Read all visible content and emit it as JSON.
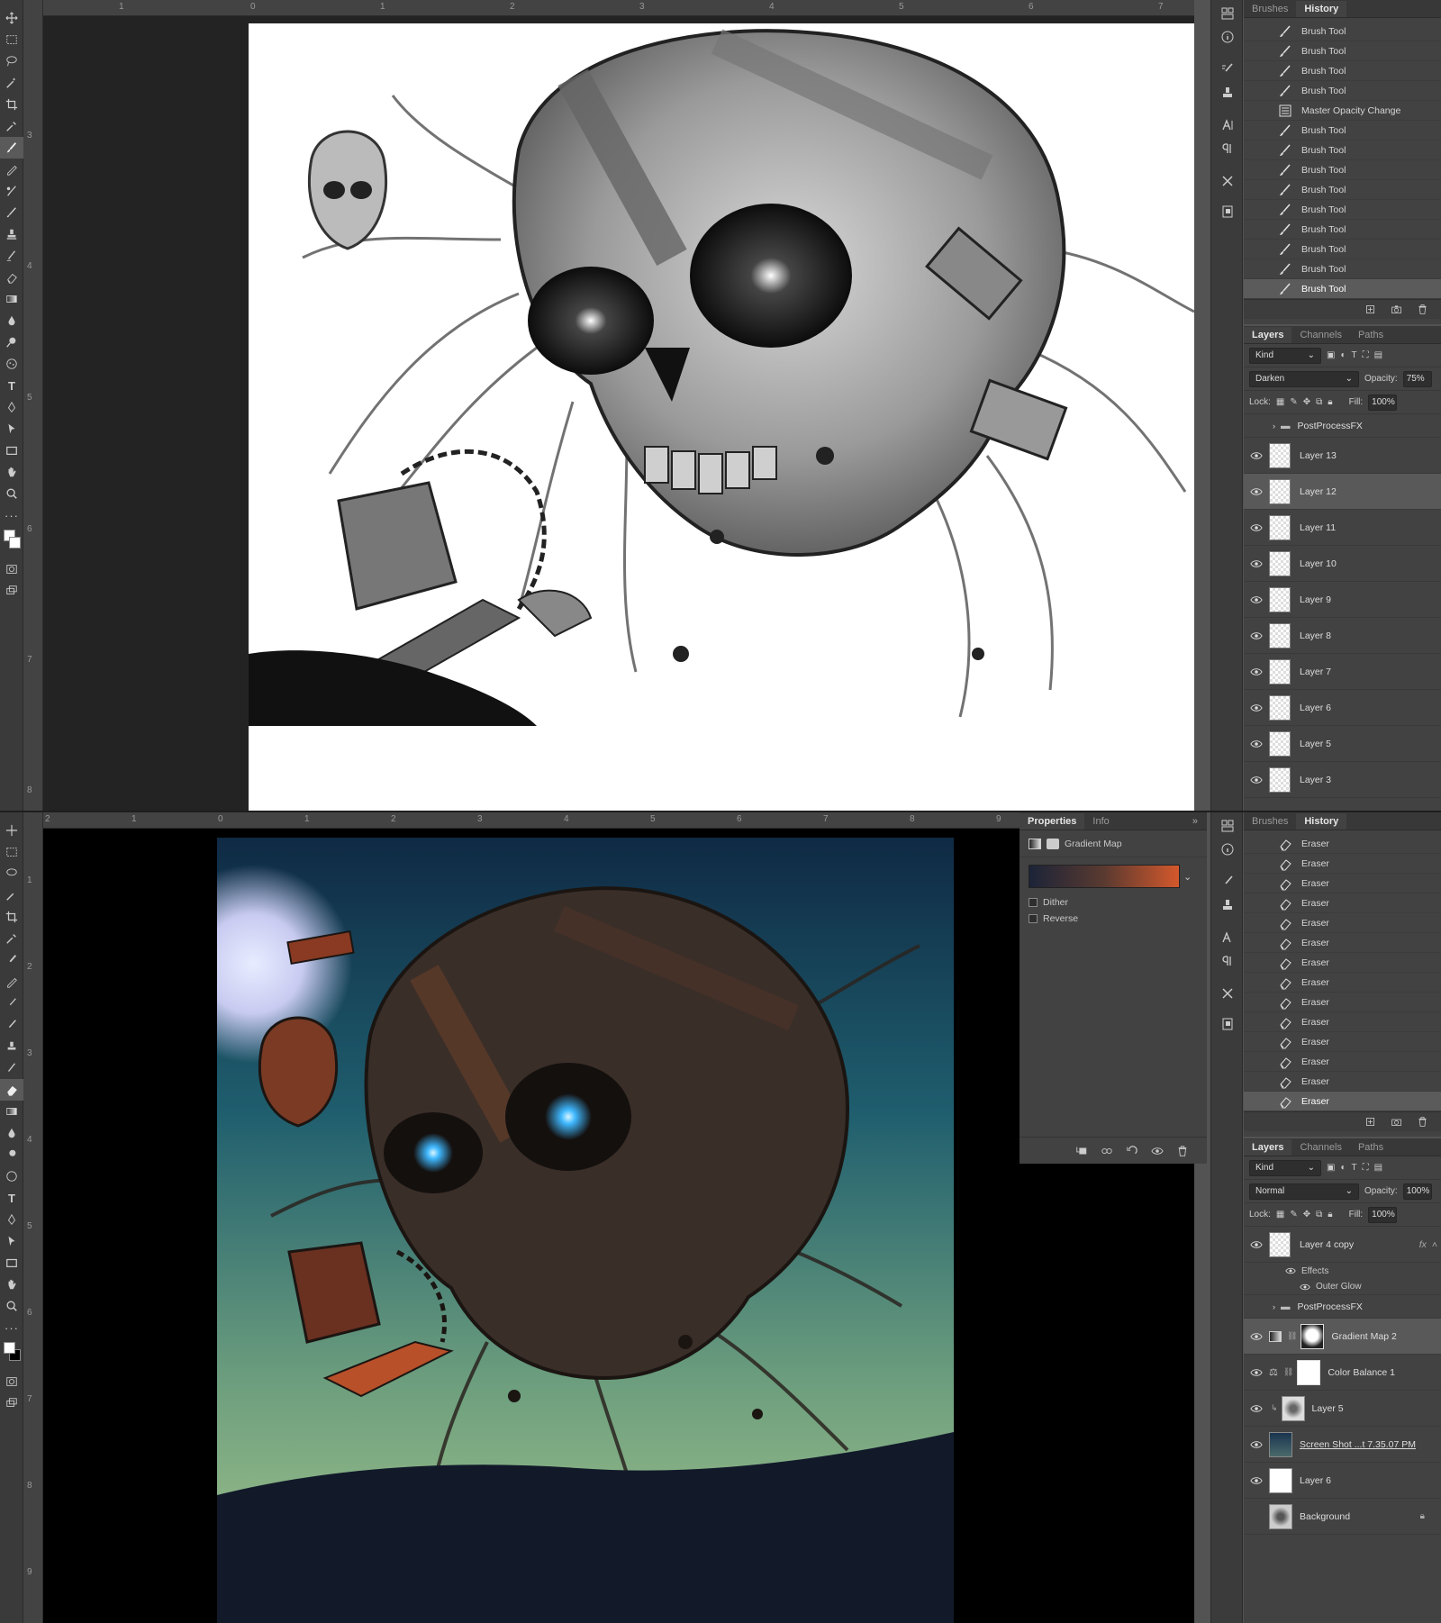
{
  "top": {
    "ruler_h_labels": [
      "1",
      "0",
      "1",
      "2",
      "3",
      "4",
      "5",
      "6",
      "7"
    ],
    "ruler_v_labels": [
      "3",
      "4",
      "5",
      "6",
      "7",
      "8"
    ],
    "history": {
      "tabs": [
        "Brushes",
        "History"
      ],
      "items": [
        "Brush Tool",
        "Brush Tool",
        "Brush Tool",
        "Brush Tool",
        "Master Opacity Change",
        "Brush Tool",
        "Brush Tool",
        "Brush Tool",
        "Brush Tool",
        "Brush Tool",
        "Brush Tool",
        "Brush Tool",
        "Brush Tool",
        "Brush Tool"
      ],
      "selected_index": 13
    },
    "layers": {
      "tabs": [
        "Layers",
        "Channels",
        "Paths"
      ],
      "kind": "Kind",
      "blend_mode": "Darken",
      "opacity_label": "Opacity:",
      "opacity": "75%",
      "lock_label": "Lock:",
      "fill_label": "Fill:",
      "fill": "100%",
      "group": "PostProcessFX",
      "items": [
        "Layer 13",
        "Layer 12",
        "Layer 11",
        "Layer 10",
        "Layer 9",
        "Layer 8",
        "Layer 7",
        "Layer 6",
        "Layer 5",
        "Layer 3"
      ],
      "selected_index": 1
    }
  },
  "bottom": {
    "ruler_h_labels": [
      "2",
      "1",
      "0",
      "1",
      "2",
      "3",
      "4",
      "5",
      "6",
      "7",
      "8",
      "9"
    ],
    "ruler_v_labels": [
      "1",
      "2",
      "3",
      "4",
      "5",
      "6",
      "7",
      "8",
      "9"
    ],
    "properties": {
      "tabs": [
        "Properties",
        "Info"
      ],
      "title": "Gradient Map",
      "dither": "Dither",
      "reverse": "Reverse",
      "gradient_colors": [
        "#1c2438",
        "#5a3a30",
        "#d4582c"
      ]
    },
    "history": {
      "tabs": [
        "Brushes",
        "History"
      ],
      "items": [
        "Eraser",
        "Eraser",
        "Eraser",
        "Eraser",
        "Eraser",
        "Eraser",
        "Eraser",
        "Eraser",
        "Eraser",
        "Eraser",
        "Eraser",
        "Eraser",
        "Eraser",
        "Eraser"
      ],
      "selected_index": 13
    },
    "layers": {
      "tabs": [
        "Layers",
        "Channels",
        "Paths"
      ],
      "kind": "Kind",
      "blend_mode": "Normal",
      "opacity_label": "Opacity:",
      "opacity": "100%",
      "lock_label": "Lock:",
      "fill_label": "Fill:",
      "fill": "100%",
      "layer4copy": "Layer 4 copy",
      "fx": "fx",
      "effects": "Effects",
      "outer_glow": "Outer Glow",
      "group": "PostProcessFX",
      "gradient_map": "Gradient Map 2",
      "color_balance": "Color Balance 1",
      "layer5": "Layer 5",
      "screenshot": "Screen Shot ...t 7.35.07 PM",
      "layer6": "Layer 6",
      "background": "Background"
    }
  },
  "colors": {
    "ui_bg": "#535353",
    "panel": "#424242",
    "accent_glow": "#3fb8ff",
    "sky_top": "#143048",
    "sky_bottom": "#8fb88a",
    "rust": "#b8502a"
  }
}
